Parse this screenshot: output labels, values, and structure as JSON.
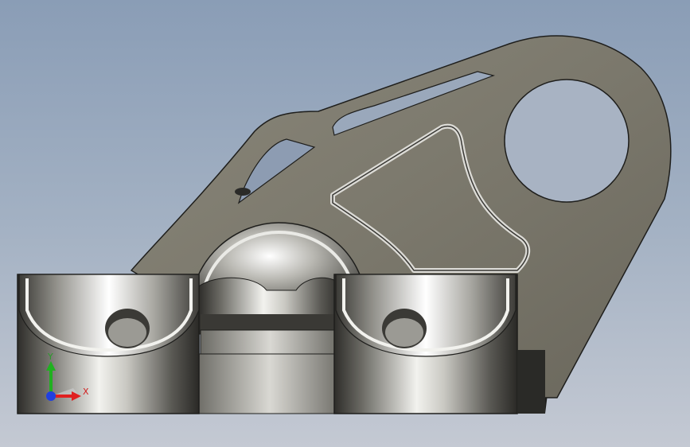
{
  "triad": {
    "y_label": "Y",
    "x_label": "X",
    "colors": {
      "x": "#e02020",
      "y": "#20b020",
      "z": "#2040e0"
    }
  }
}
